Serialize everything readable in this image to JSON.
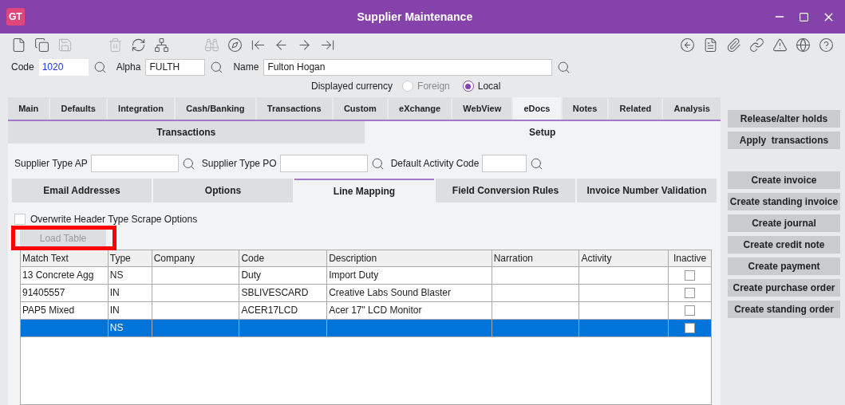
{
  "window": {
    "logo": "GT",
    "title": "Supplier Maintenance"
  },
  "toolbar_left": [
    {
      "kind": "new",
      "disabled": false
    },
    {
      "kind": "copy",
      "disabled": false
    },
    {
      "kind": "save",
      "disabled": true
    },
    {
      "kind": "gap"
    },
    {
      "kind": "delete",
      "disabled": true
    },
    {
      "kind": "refresh",
      "disabled": false
    },
    {
      "kind": "tree",
      "disabled": false
    },
    {
      "kind": "gap"
    },
    {
      "kind": "find",
      "disabled": true
    },
    {
      "kind": "compass",
      "disabled": false
    },
    {
      "kind": "first",
      "disabled": false
    },
    {
      "kind": "prev",
      "disabled": false
    },
    {
      "kind": "next",
      "disabled": false
    },
    {
      "kind": "last",
      "disabled": false
    }
  ],
  "toolbar_right": [
    {
      "kind": "back"
    },
    {
      "kind": "document"
    },
    {
      "kind": "attach"
    },
    {
      "kind": "link"
    },
    {
      "kind": "alert"
    },
    {
      "kind": "globe"
    },
    {
      "kind": "help"
    }
  ],
  "fields": [
    {
      "label": "Code",
      "value": "1020"
    },
    {
      "label": "Alpha",
      "value": "FULTH"
    },
    {
      "label": "Name",
      "value": "Fulton Hogan"
    }
  ],
  "currency": {
    "label": "Displayed currency",
    "options": [
      {
        "label": "Foreign",
        "selected": false,
        "disabled": true
      },
      {
        "label": "Local",
        "selected": true,
        "disabled": false
      }
    ]
  },
  "tabs": [
    {
      "label": "Main",
      "selected": false
    },
    {
      "label": "Defaults",
      "selected": false
    },
    {
      "label": "Integration",
      "selected": false
    },
    {
      "label": "Cash/Banking",
      "selected": false
    },
    {
      "label": "Transactions",
      "selected": false
    },
    {
      "label": "Custom",
      "selected": false
    },
    {
      "label": "eXchange",
      "selected": false
    },
    {
      "label": "WebView",
      "selected": false
    },
    {
      "label": "eDocs",
      "selected": true
    },
    {
      "label": "Notes",
      "selected": false
    },
    {
      "label": "Related",
      "selected": false
    },
    {
      "label": "Analysis",
      "selected": false
    }
  ],
  "subtabs": [
    {
      "label": "Transactions",
      "selected": false
    },
    {
      "label": "Setup",
      "selected": true
    }
  ],
  "setup_fields": [
    {
      "label": "Supplier Type AP"
    },
    {
      "label": "Supplier Type PO"
    },
    {
      "label": "Default Activity Code"
    }
  ],
  "setup_tabs": [
    {
      "label": "Email Addresses",
      "selected": false
    },
    {
      "label": "Options",
      "selected": false
    },
    {
      "label": "Line Mapping",
      "selected": true
    },
    {
      "label": "Field Conversion Rules",
      "selected": false
    },
    {
      "label": "Invoice Number Validation",
      "selected": false
    }
  ],
  "overwrite": {
    "label": "Overwrite Header Type Scrape Options",
    "checked": false
  },
  "load_button": {
    "label": "Load Table",
    "disabled": true
  },
  "table": {
    "columns": [
      "Match Text",
      "Type",
      "Company",
      "Code",
      "Description",
      "Narration",
      "Activity",
      "Inactive"
    ],
    "rows": [
      {
        "match": "13 Concrete Agg",
        "type": "NS",
        "company": "",
        "code": "Duty",
        "description": "Import Duty",
        "narration": "",
        "activity": "",
        "inactive": false,
        "selected": false
      },
      {
        "match": "91405557",
        "type": "IN",
        "company": "",
        "code": "SBLIVESCARD",
        "description": "Creative Labs Sound Blaster",
        "narration": "",
        "activity": "",
        "inactive": false,
        "selected": false
      },
      {
        "match": "PAP5 Mixed",
        "type": "IN",
        "company": "",
        "code": "ACER17LCD",
        "description": "Acer 17\" LCD Monitor",
        "narration": "",
        "activity": "",
        "inactive": false,
        "selected": false
      },
      {
        "match": "",
        "type": "NS",
        "company": "",
        "code": "",
        "description": "",
        "narration": "",
        "activity": "",
        "inactive": false,
        "selected": true
      }
    ]
  },
  "side_buttons": [
    "Release/alter holds",
    "Apply  transactions",
    "Create invoice",
    "Create standing invoice",
    "Create journal",
    "Create credit note",
    "Create payment",
    "Create purchase order",
    "Create standing order"
  ]
}
